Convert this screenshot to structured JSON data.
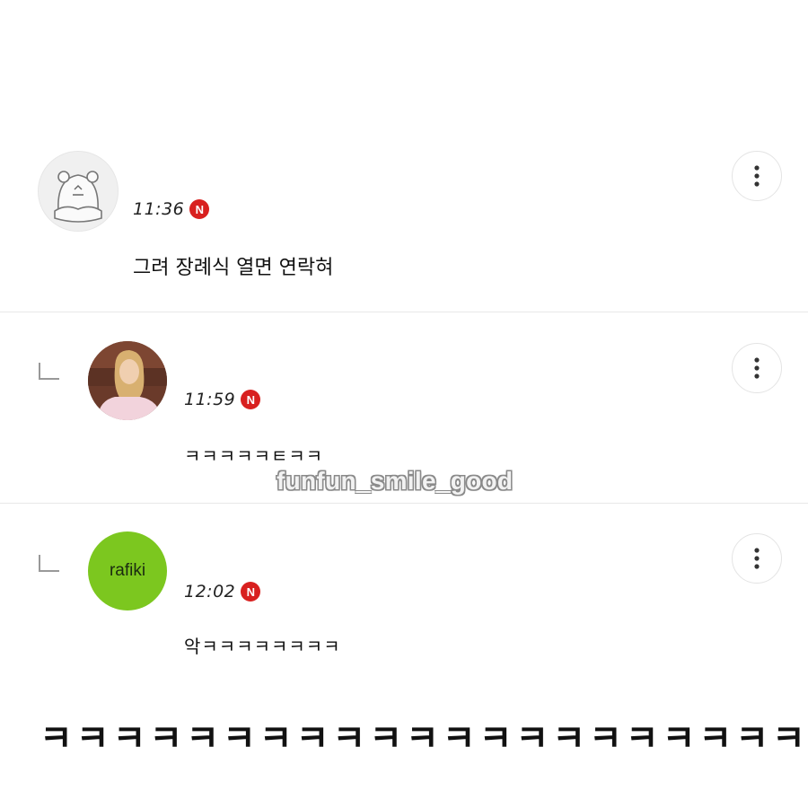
{
  "comments": [
    {
      "time": "11:36",
      "badge": "N",
      "text": "그려 장례식 열면 연락혀",
      "avatar": "hamster-sketch-avatar",
      "reply": false
    },
    {
      "time": "11:59",
      "badge": "N",
      "text": "ㅋㅋㅋㅋㅋㅌㅋㅋ",
      "avatar": "photo-avatar",
      "reply": true
    },
    {
      "time": "12:02",
      "badge": "N",
      "text": "악ㅋㅋㅋㅋㅋㅋㅋㅋ",
      "avatar": "rafiki-avatar",
      "avatar_label": "rafiki",
      "reply": true
    }
  ],
  "watermark": "funfun_smile_good",
  "caption": "ㅋㅋㅋㅋㅋㅋㅋㅋㅋㅋㅋㅋㅋㅋㅋㅋㅋㅋㅋㅋㅋ",
  "colors": {
    "badge": "#d8201f",
    "rafiki_avatar_bg": "#7cc71f",
    "divider": "#e8e8e8"
  },
  "icons": {
    "more": "vertical-ellipsis-icon",
    "reply": "reply-corner-icon",
    "new": "new-badge-icon"
  }
}
